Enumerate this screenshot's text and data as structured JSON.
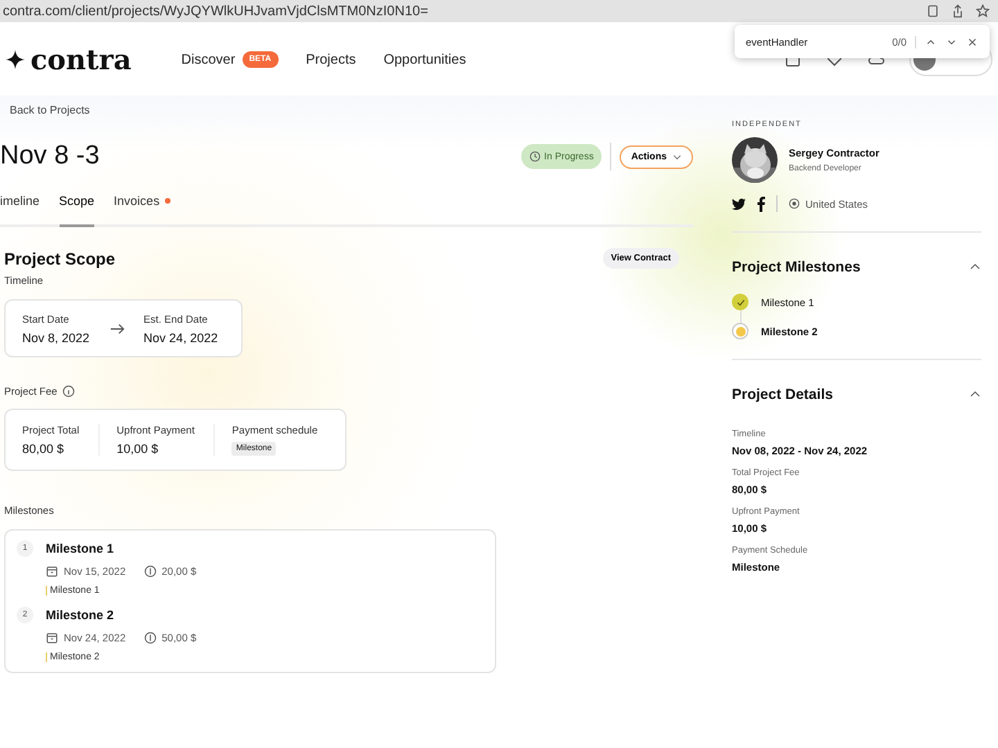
{
  "browser": {
    "url": "contra.com/client/projects/WyJQYWlkUHJvamVjdClsMTM0NzI0N10="
  },
  "find_bar": {
    "value": "eventHandler",
    "count": "0/0"
  },
  "nav": {
    "logo": "contra",
    "items": [
      {
        "label": "Discover",
        "badge": "BETA"
      },
      {
        "label": "Projects"
      },
      {
        "label": "Opportunities"
      }
    ]
  },
  "back_link": "Back to Projects",
  "title": "Nov 8 -3",
  "status": "In Progress",
  "actions": "Actions",
  "tabs": [
    {
      "label": "imeline",
      "selected": false,
      "dot": false
    },
    {
      "label": "Scope",
      "selected": true,
      "dot": false
    },
    {
      "label": "Invoices",
      "selected": false,
      "dot": true
    }
  ],
  "scope": {
    "title": "Project Scope",
    "view_contract": "View Contract",
    "timeline_label": "Timeline",
    "start": {
      "label": "Start Date",
      "value": "Nov 8, 2022"
    },
    "end": {
      "label": "Est. End Date",
      "value": "Nov 24, 2022"
    },
    "fee_label": "Project Fee",
    "fee": {
      "total_label": "Project Total",
      "total": "80,00 $",
      "upfront_label": "Upfront Payment",
      "upfront": "10,00 $",
      "schedule_label": "Payment schedule",
      "schedule": "Milestone"
    },
    "milestones_label": "Milestones",
    "milestones": [
      {
        "number": "1",
        "name": "Milestone 1",
        "date": "Nov 15, 2022",
        "amount": "20,00 $",
        "note": "Milestone 1"
      },
      {
        "number": "2",
        "name": "Milestone 2",
        "date": "Nov 24, 2022",
        "amount": "50,00 $",
        "note": "Milestone 2"
      }
    ]
  },
  "sidebar": {
    "label": "INDEPENDENT",
    "name": "Sergey Contractor",
    "role": "Backend Developer",
    "location": "United States",
    "milestones_title": "Project Milestones",
    "milestones": [
      {
        "name": "Milestone 1",
        "done": true,
        "current": false
      },
      {
        "name": "Milestone 2",
        "done": false,
        "current": true
      }
    ],
    "details_title": "Project Details",
    "details": [
      {
        "label": "Timeline",
        "value": "Nov 08, 2022 - Nov 24, 2022"
      },
      {
        "label": "Total Project Fee",
        "value": "80,00 $"
      },
      {
        "label": "Upfront Payment",
        "value": "10,00 $"
      },
      {
        "label": "Payment Schedule",
        "value": "Milestone"
      }
    ]
  }
}
